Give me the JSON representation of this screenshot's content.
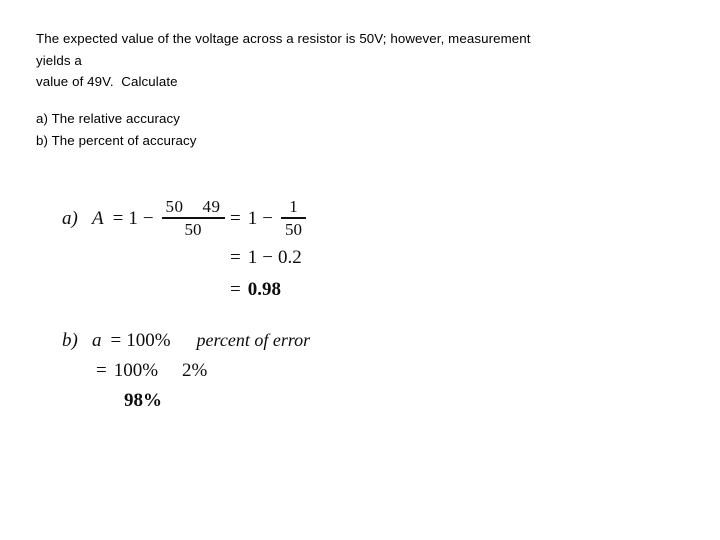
{
  "slide": {
    "background_color": "#ffffff",
    "text_color": "#000000"
  },
  "statement": {
    "lines": [
      "The expected value of the voltage across a resistor is 50V; however, measurement",
      "yields a",
      "value of 49V.  Calculate"
    ]
  },
  "questions": {
    "items": [
      "a) The relative accuracy",
      "b) The percent of accuracy"
    ]
  },
  "solution": {
    "part_a": {
      "label": "a)",
      "variable": "A",
      "equals": "=",
      "one": "1",
      "minus": "−",
      "fraction": {
        "numerator": "50    49",
        "denominator": "50"
      },
      "step2": {
        "equals": "=",
        "one": "1",
        "minus": "−",
        "fraction": {
          "numerator": "1",
          "denominator": "50"
        }
      },
      "step3": {
        "equals": "=",
        "one": "1",
        "minus": "−",
        "value": "0.2"
      },
      "step4": {
        "equals": "=",
        "result": "0.98"
      }
    },
    "part_b": {
      "label": "b)",
      "variable": "a",
      "equals": "=",
      "value": "100%",
      "phrase": "percent of error",
      "step2": {
        "equals": "=",
        "value": "100%",
        "term": "2%"
      },
      "step3": {
        "result": "98%"
      }
    }
  }
}
